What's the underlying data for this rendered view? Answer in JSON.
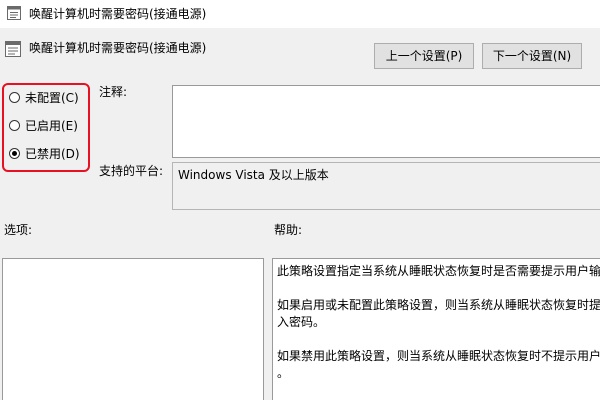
{
  "window": {
    "title": "唤醒计算机时需要密码(接通电源)"
  },
  "header": {
    "policy_title": "唤醒计算机时需要密码(接通电源)",
    "prev_button": "上一个设置(P)",
    "next_button": "下一个设置(N)"
  },
  "state": {
    "options": [
      {
        "label": "未配置(C)",
        "checked": false
      },
      {
        "label": "已启用(E)",
        "checked": false
      },
      {
        "label": "已禁用(D)",
        "checked": true
      }
    ],
    "highlight_color": "#e81123"
  },
  "comment": {
    "label": "注释:",
    "value": ""
  },
  "platform": {
    "label": "支持的平台:",
    "value": "Windows Vista 及以上版本"
  },
  "options_panel": {
    "label": "选项:"
  },
  "help_panel": {
    "label": "帮助:",
    "paragraphs": [
      [
        "此策略设置指定当系统从睡眠状态恢复时是否需要提示用户输"
      ],
      [
        "如果启用或未配置此策略设置，则当系统从睡眠状态恢复时提",
        "入密码。"
      ],
      [
        "如果禁用此策略设置，则当系统从睡眠状态恢复时不提示用户",
        "。"
      ]
    ]
  }
}
